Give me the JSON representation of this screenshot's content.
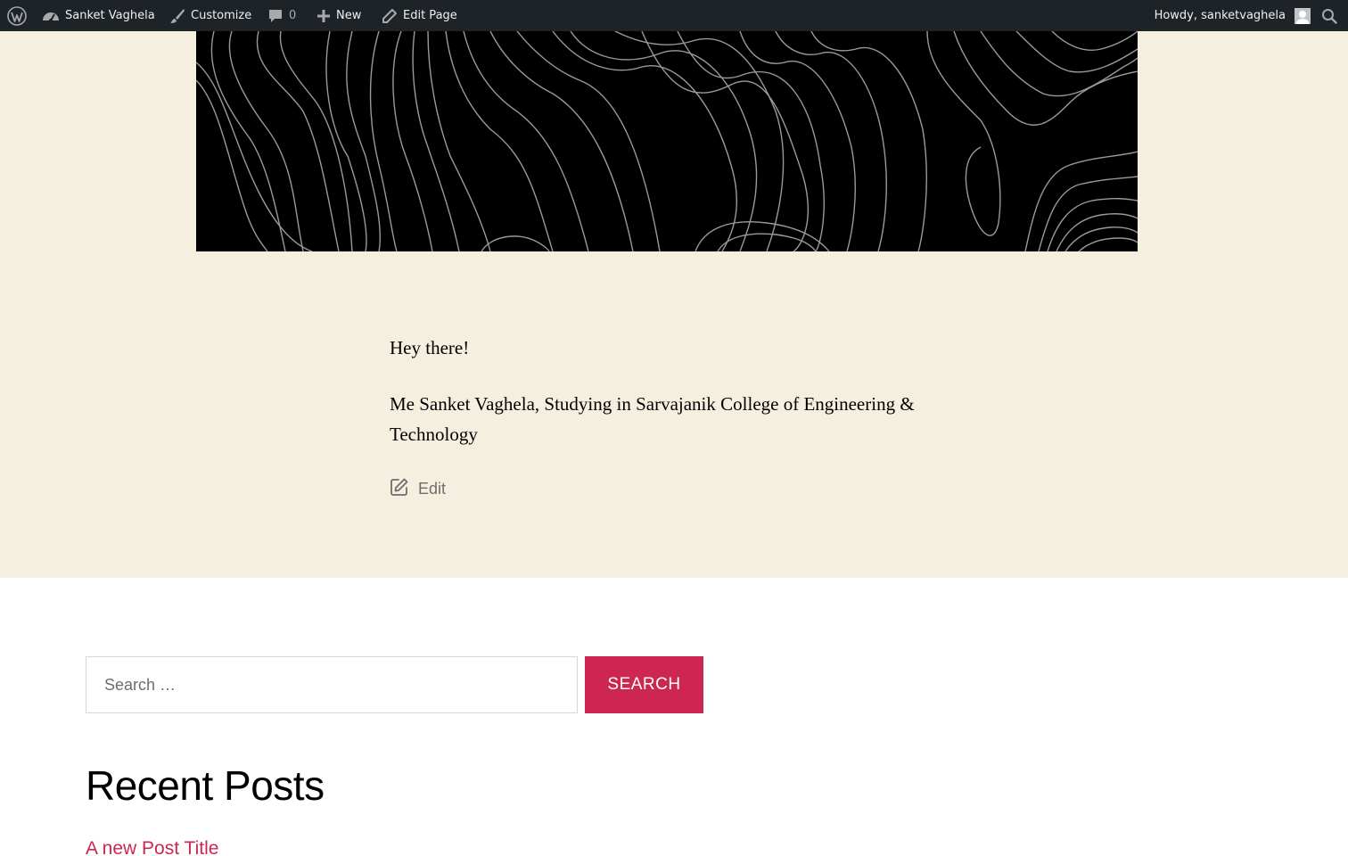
{
  "admin_bar": {
    "site_name": "Sanket Vaghela",
    "customize": "Customize",
    "comments_count": "0",
    "new_label": "New",
    "edit_page": "Edit Page",
    "howdy": "Howdy, sanketvaghela"
  },
  "page": {
    "paragraphs": [
      "Hey there!",
      "Me Sanket Vaghela, Studying in Sarvajanik College of Engineering & Technology"
    ],
    "edit_label": "Edit"
  },
  "search": {
    "placeholder": "Search …",
    "button_label": "Search"
  },
  "recent_posts": {
    "title": "Recent Posts",
    "items": [
      "A new Post Title"
    ]
  },
  "colors": {
    "admin_bar_bg": "#1d2327",
    "content_bg": "#f5efe0",
    "accent": "#cd2653"
  }
}
